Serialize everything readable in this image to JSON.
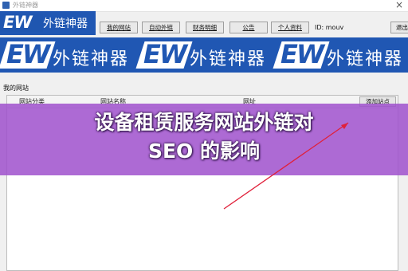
{
  "window": {
    "title": "外链神器",
    "close_glyph": "×"
  },
  "logo": {
    "ew": "EW",
    "cn": "外链神器"
  },
  "tabs": [
    {
      "label": "我的网站"
    },
    {
      "label": "自动外链"
    },
    {
      "label": "财务明细"
    },
    {
      "label": "公告"
    },
    {
      "label": "个人资料"
    }
  ],
  "user": {
    "id_label": "ID: mouv"
  },
  "exit_label": "退出",
  "banner": {
    "ew": "EW",
    "cn": "外链神器"
  },
  "section": {
    "title": "我的网站"
  },
  "table": {
    "columns": [
      "网站分类",
      "网站名称",
      "网址"
    ],
    "add_button": "添加站点"
  },
  "overlay": {
    "line1": "设备租赁服务网站外链对",
    "line2": "SEO 的影响",
    "color": "#a052cd"
  },
  "colors": {
    "brand_blue": "#2057b3",
    "arrow_red": "#e0203a"
  }
}
